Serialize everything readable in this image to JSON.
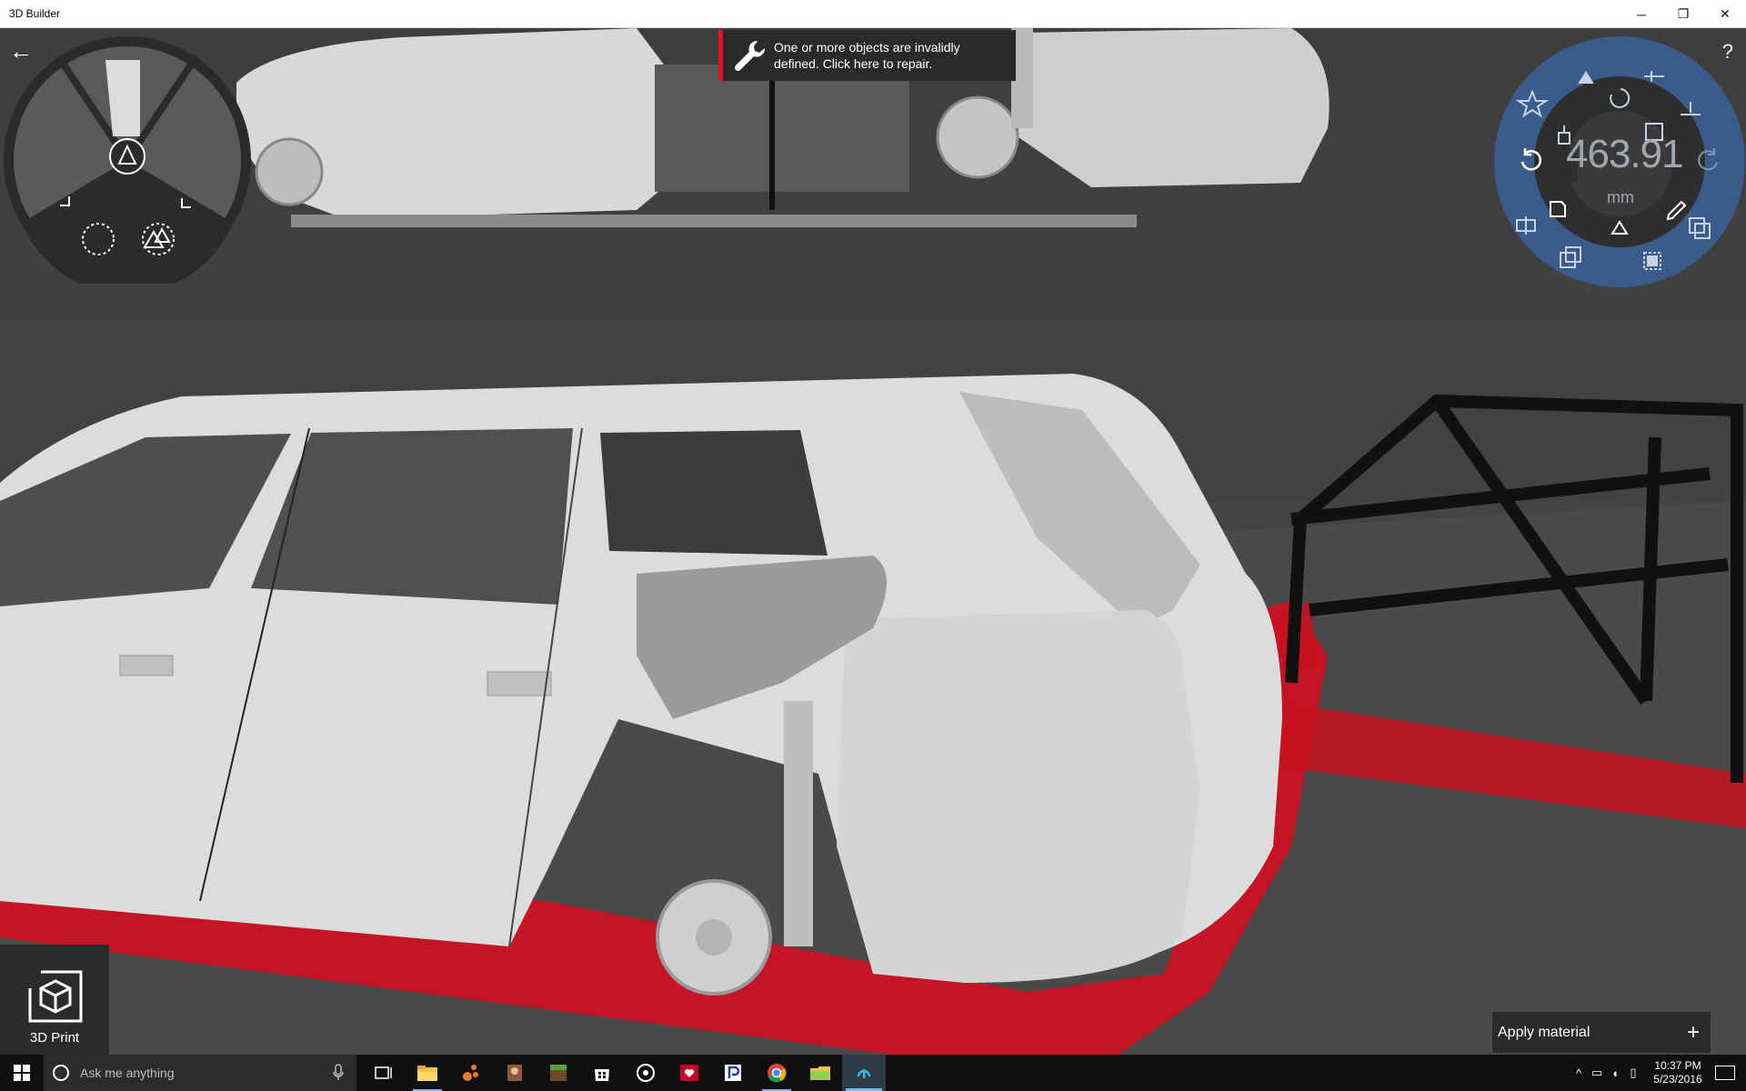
{
  "window": {
    "title": "3D Builder",
    "minimize_glyph": "─",
    "maximize_glyph": "❐",
    "close_glyph": "✕"
  },
  "nav": {
    "back_glyph": "←",
    "help_glyph": "?"
  },
  "notification": {
    "message": "One or more objects are invalidly defined. Click here to repair.",
    "accent": "#e81123"
  },
  "measure": {
    "value": "463.91",
    "unit": "mm"
  },
  "left_radial": {
    "tools": [
      "triangle-tool-icon",
      "circle-tool-icon",
      "mountain-triangle-icon",
      "bracket-left-icon",
      "bracket-right-icon"
    ]
  },
  "right_radial": {
    "tools": [
      "star-icon",
      "move-up-icon",
      "align-icon",
      "rotate-icon",
      "scale-icon",
      "lay-flat-icon",
      "move-icon",
      "undo-icon",
      "redo-icon",
      "file-icon",
      "triangle-icon",
      "pencil-icon",
      "split-icon",
      "merge-icon",
      "select-icon",
      "duplicate-icon"
    ],
    "ring_color": "#3b5b8d"
  },
  "print_button": {
    "label": "3D Print"
  },
  "material": {
    "label": "Apply material",
    "plus_glyph": "+"
  },
  "taskbar": {
    "search_placeholder": "Ask me anything",
    "apps": [
      "task-view-icon",
      "file-explorer-icon",
      "app-dots-icon",
      "game-icon",
      "minecraft-icon",
      "store-icon",
      "groove-icon",
      "iheart-icon",
      "pandora-icon",
      "chrome-icon",
      "folder-icon",
      "3d-builder-icon"
    ],
    "time": "10:37 PM",
    "date": "5/23/2016"
  }
}
